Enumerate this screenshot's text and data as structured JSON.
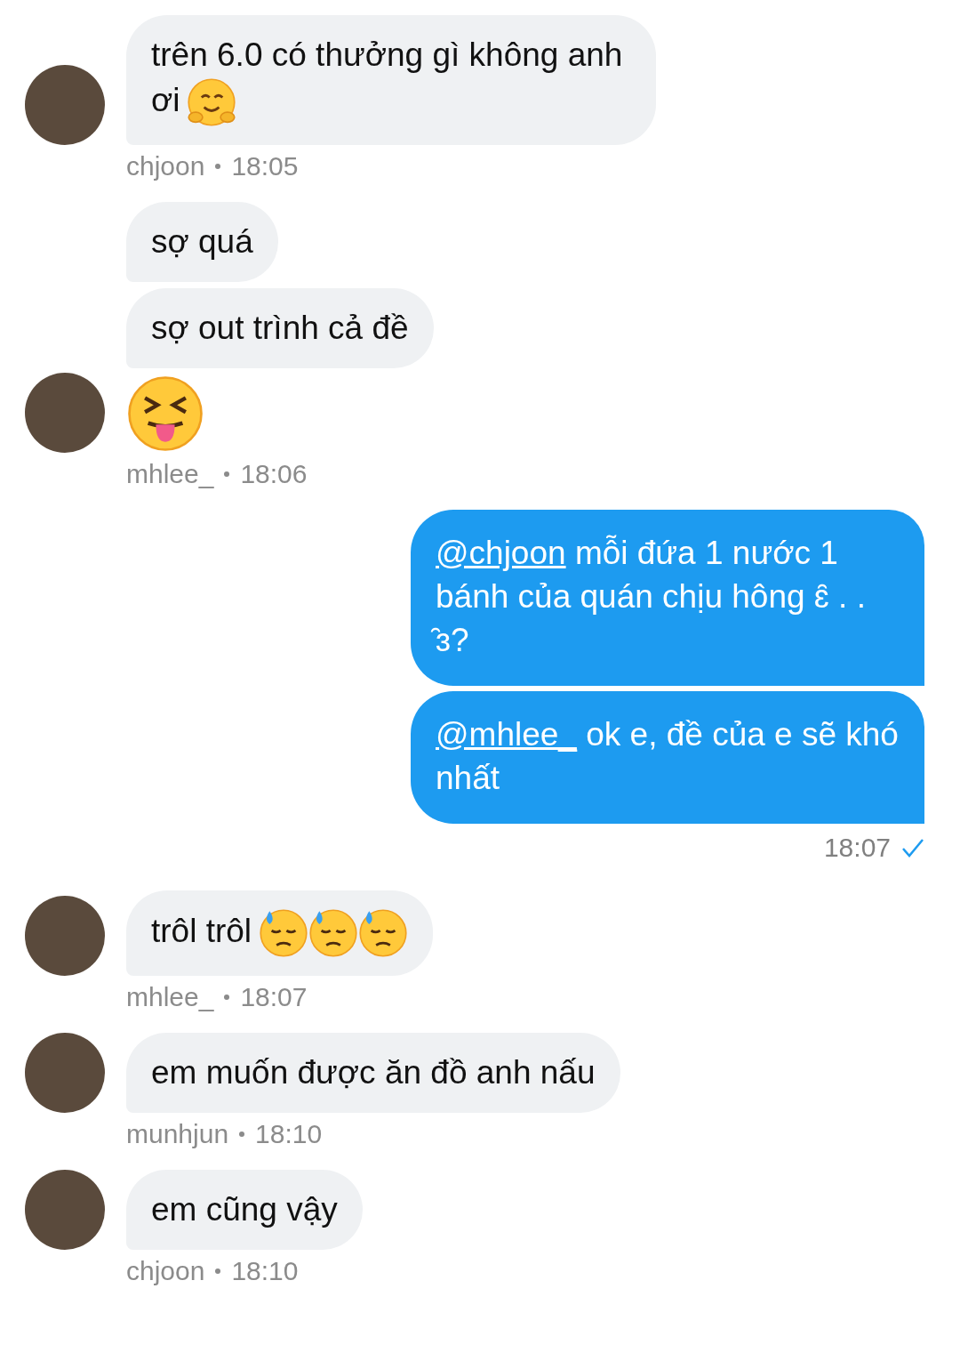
{
  "messages": [
    {
      "kind": "received",
      "bubbles": [
        {
          "kind": "text",
          "text": "trên 6.0 có thưởng gì không anh ơi",
          "emojis": [
            {
              "kind": "hug"
            }
          ]
        }
      ],
      "sender": "chjoon",
      "time": "18:05"
    },
    {
      "kind": "received",
      "bubbles": [
        {
          "kind": "text",
          "text": "sợ quá"
        },
        {
          "kind": "text",
          "text": "sợ out trình cả đề"
        },
        {
          "kind": "emoji",
          "emojis": [
            {
              "kind": "tongue"
            }
          ]
        }
      ],
      "sender": "mhlee_",
      "time": "18:06"
    },
    {
      "kind": "sent",
      "bubbles": [
        {
          "kind": "text",
          "mention": "@chjoon",
          "text": "mỗi đứa 1 nước 1 bánh của quán chịu hông ɛ̑ . . ̑ɜ?"
        },
        {
          "kind": "text",
          "mention": "@mhlee_",
          "text": "ok e, đề của e sẽ khó nhất"
        }
      ],
      "time": "18:07",
      "read": true
    },
    {
      "kind": "received",
      "bubbles": [
        {
          "kind": "text",
          "text": "trôl trôl",
          "emojis": [
            {
              "kind": "sweat"
            },
            {
              "kind": "sweat"
            },
            {
              "kind": "sweat"
            }
          ]
        }
      ],
      "sender": "mhlee_",
      "time": "18:07"
    },
    {
      "kind": "received",
      "bubbles": [
        {
          "kind": "text",
          "text": "em muốn được ăn đồ anh nấu"
        }
      ],
      "sender": "munhjun",
      "time": "18:10"
    },
    {
      "kind": "received",
      "bubbles": [
        {
          "kind": "text",
          "text": "em cũng vậy"
        }
      ],
      "sender": "chjoon",
      "time": "18:10"
    }
  ]
}
